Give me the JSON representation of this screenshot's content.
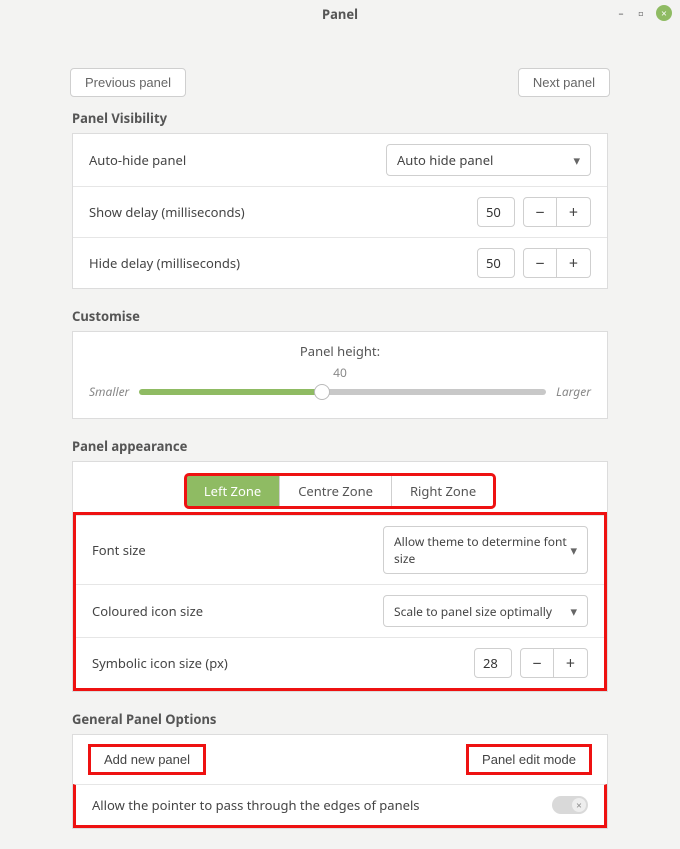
{
  "window": {
    "title": "Panel",
    "minimize": "–",
    "maximize": "⬜",
    "close": "×"
  },
  "nav": {
    "prev": "Previous panel",
    "next": "Next panel"
  },
  "visibility": {
    "title": "Panel Visibility",
    "autohide_label": "Auto-hide panel",
    "autohide_value": "Auto hide panel",
    "showdelay_label": "Show delay (milliseconds)",
    "showdelay_value": "50",
    "hidedelay_label": "Hide delay (milliseconds)",
    "hidedelay_value": "50"
  },
  "customise": {
    "title": "Customise",
    "height_label": "Panel height:",
    "height_value": "40",
    "smaller": "Smaller",
    "larger": "Larger"
  },
  "appearance": {
    "title": "Panel appearance",
    "tabs": {
      "left": "Left Zone",
      "centre": "Centre Zone",
      "right": "Right Zone"
    },
    "fontsize_label": "Font size",
    "fontsize_value": "Allow theme to determine font size",
    "colicon_label": "Coloured icon size",
    "colicon_value": "Scale to panel size optimally",
    "symicon_label": "Symbolic icon size (px)",
    "symicon_value": "28"
  },
  "general": {
    "title": "General Panel Options",
    "add": "Add new panel",
    "edit": "Panel edit mode",
    "pointer_label": "Allow the pointer to pass through the edges of panels"
  },
  "glyph": {
    "chevron": "▾",
    "minus": "−",
    "plus": "+",
    "off": "×"
  }
}
